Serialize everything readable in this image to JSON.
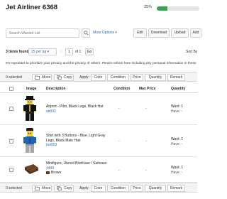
{
  "header": {
    "title": "Jet Airliner 6368",
    "progress_label": "25%",
    "progress_value": 0.25,
    "progress_color": "#2fa84f"
  },
  "toolbar": {
    "search_placeholder": "Search Wanted List",
    "more_options": "More Options",
    "edit": "Edit",
    "download": "Download",
    "upload": "Upload",
    "add": "Add"
  },
  "pager": {
    "found_count": "3 items found",
    "per_page": "25 per pg",
    "page": "1",
    "of": "of 1",
    "go": "Go",
    "sort_by": "Sort By"
  },
  "notice": "It's important to prioritize your privacy and the privacy of others. Please refrain from including any personal information in these",
  "action_bar": {
    "selected": "0 selected",
    "move": "Move",
    "copy": "Copy",
    "apply": "Apply:",
    "color": "Color",
    "condition": "Condition",
    "price": "Price",
    "quantity": "Quantity",
    "remark": "Remark"
  },
  "table": {
    "headers": {
      "image": "Image",
      "description": "Description",
      "condition": "Condition",
      "max_price": "Max Price",
      "quantity": "Quantity"
    },
    "rows": [
      {
        "title": "Airport - Pilot, Black Legs, Black Hat",
        "code": "air002",
        "condition": "-",
        "max_price": "-",
        "want": "Want: 1",
        "have": "Have: -"
      },
      {
        "title": "Shirt with 3 Buttons - Blue, Light Gray Legs, Black Male Hair",
        "code": "but003",
        "condition": "-",
        "max_price": "-",
        "want": "Want: 1",
        "have": "Have: -"
      },
      {
        "title": "Minifigure, Utensil Briefcase / Suitcase",
        "code": "4449",
        "color": "Brown",
        "condition": "-",
        "max_price": "-",
        "want": "Want: 1",
        "have": "Have: -"
      }
    ]
  }
}
